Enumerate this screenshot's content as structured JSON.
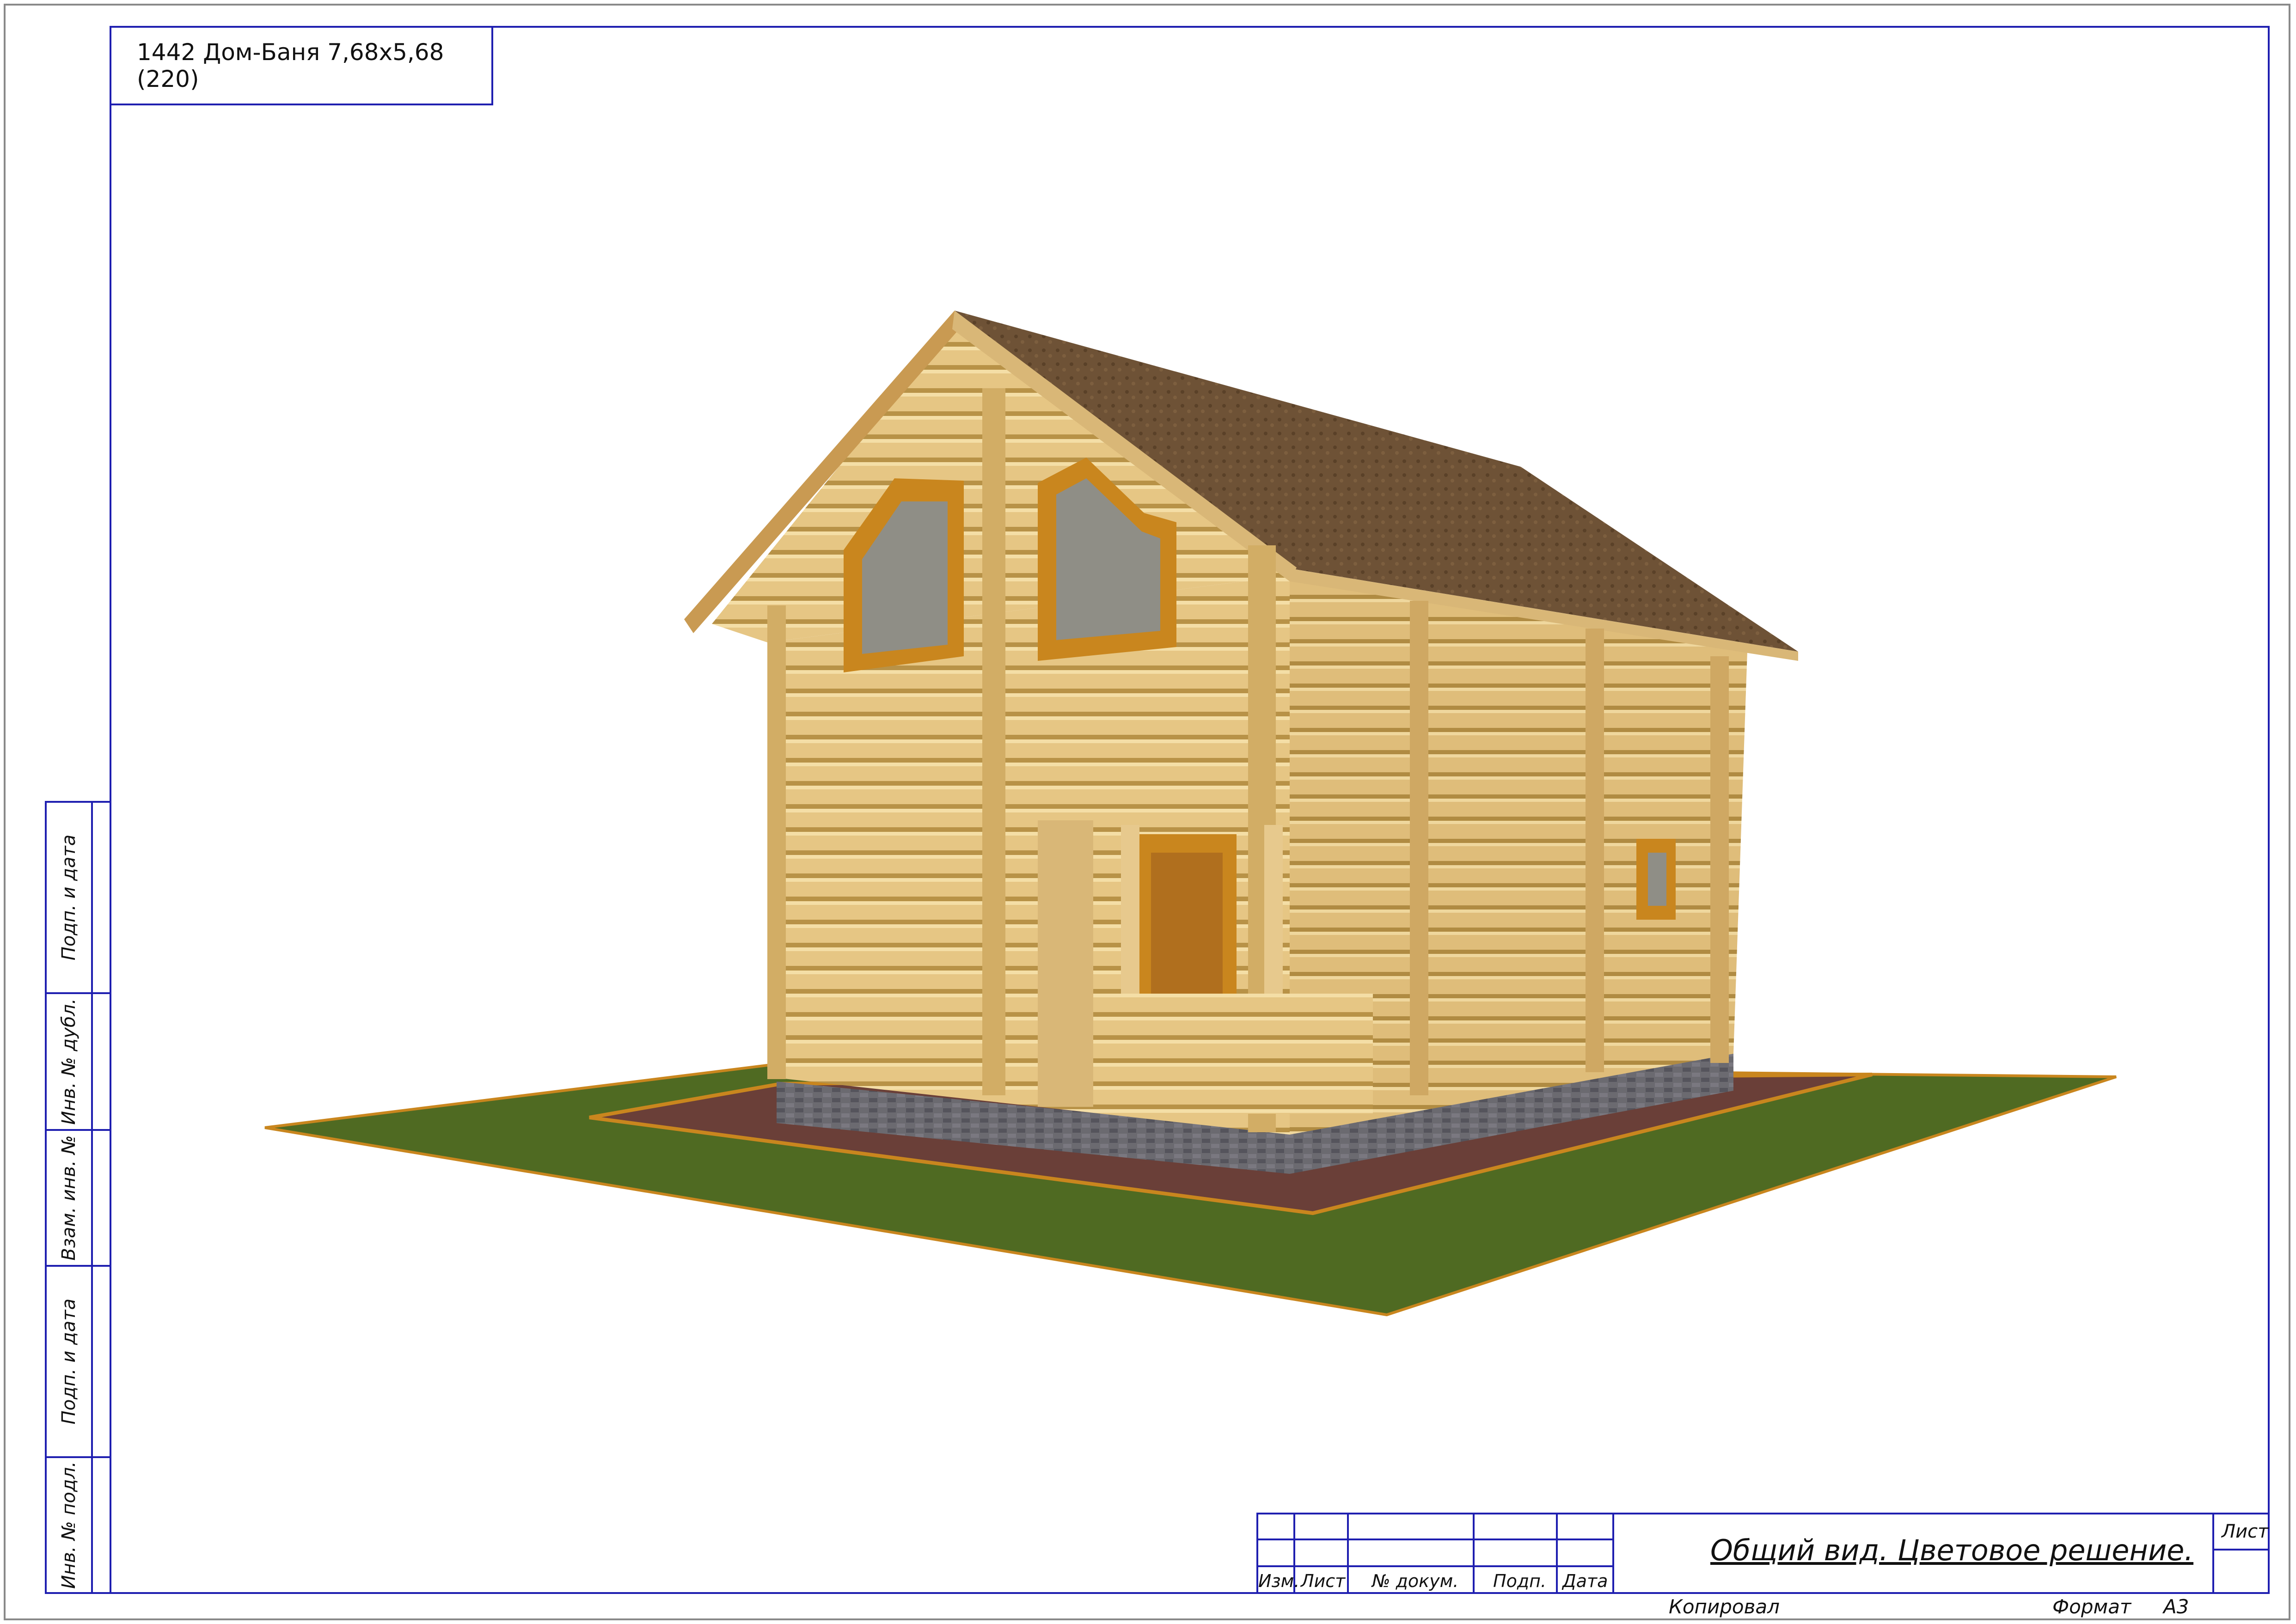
{
  "document": {
    "project_title": "1442 Дом-Баня 7,68х5,68 (220)",
    "sheet_title": "Общий вид. Цветовое решение.",
    "sheet_label": "Лист",
    "copied_label": "Копировал",
    "format_label": "Формат",
    "format_value": "А3"
  },
  "side_stamp": [
    "Подп. и дата",
    "Инв. № дубл.",
    "Взам. инв. №",
    "Подп. и дата",
    "Инв. № подл."
  ],
  "title_block": {
    "columns": [
      "Изм.",
      "Лист",
      "№ докум.",
      "Подп.",
      "Дата"
    ]
  },
  "colors": {
    "frame": "#1f1fb0",
    "log": "#e8c987",
    "roof": "#6e5236",
    "grass": "#4f6a22",
    "gravel": "#6a3f38",
    "brick": "#6b6a70",
    "trim": "#c9861e"
  }
}
